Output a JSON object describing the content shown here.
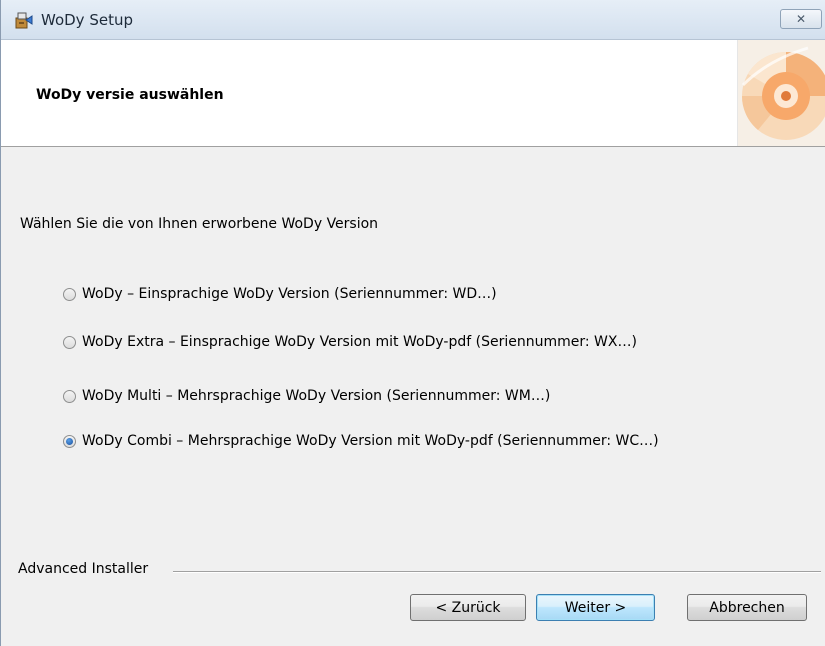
{
  "window": {
    "title": "WoDy Setup",
    "close_glyph": "✕"
  },
  "banner": {
    "title": "WoDy versie auswählen"
  },
  "main": {
    "intro": "Wählen Sie die von Ihnen erworbene WoDy Version",
    "options": [
      {
        "label": "WoDy – Einsprachige WoDy Version (Seriennummer: WD…)",
        "selected": false
      },
      {
        "label": "WoDy Extra – Einsprachige WoDy Version mit WoDy-pdf (Seriennummer: WX…)",
        "selected": false
      },
      {
        "label": "WoDy Multi – Mehrsprachige WoDy Version (Seriennummer: WM…)",
        "selected": false
      },
      {
        "label": "WoDy Combi – Mehrsprachige WoDy Version mit WoDy-pdf (Seriennummer: WC…)",
        "selected": true
      }
    ]
  },
  "footer": {
    "brand": "Advanced Installer",
    "back_label": "< Zurück",
    "next_label": "Weiter >",
    "cancel_label": "Abbrechen"
  },
  "colors": {
    "accent": "#3c7fb1",
    "logo_orange": "#f29a56"
  },
  "icons": {
    "app": "installer-icon",
    "close": "close-icon",
    "logo": "cd-disc-logo"
  }
}
